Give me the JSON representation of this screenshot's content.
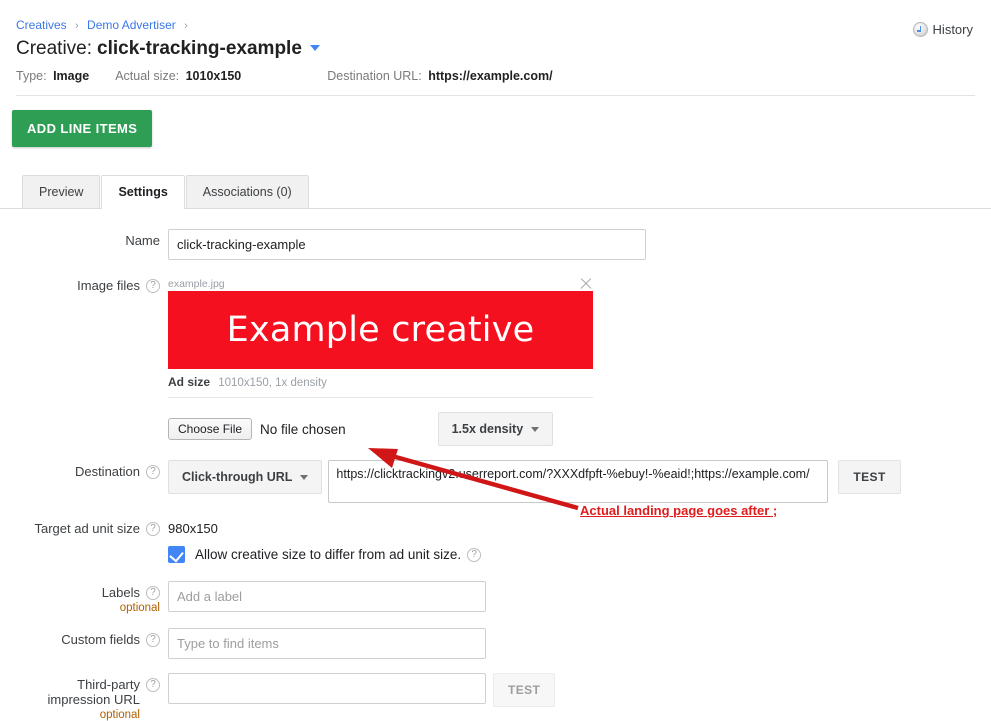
{
  "header": {
    "breadcrumb": [
      {
        "label": "Creatives"
      },
      {
        "label": "Demo Advertiser"
      }
    ],
    "breadcrumb_separator": "›",
    "title_prefix": "Creative:",
    "title_name": "click-tracking-example",
    "meta": [
      {
        "label": "Type:",
        "value": "Image"
      },
      {
        "label": "Actual size:",
        "value": "1010x150"
      },
      {
        "label": "Destination URL:",
        "value": "https://example.com/"
      }
    ],
    "history_label": "History",
    "history_icon": "clock-icon"
  },
  "toolbar": {
    "add_line_items_label": "ADD LINE ITEMS",
    "add_button_color": "#2e9e54"
  },
  "tabs": [
    {
      "label": "Preview",
      "active": false
    },
    {
      "label": "Settings",
      "active": true
    },
    {
      "label": "Associations (0)",
      "active": false
    }
  ],
  "form": {
    "help_icon_glyph": "?",
    "optional_label": "optional",
    "name": {
      "label": "Name",
      "value": "click-tracking-example"
    },
    "image_files": {
      "label": "Image files",
      "filename": "example.jpg",
      "remove_icon": "close-icon",
      "creative_text": "Example creative",
      "creative_color": "#f5101f",
      "ad_size_label": "Ad size",
      "ad_size_value": "1010x150, 1x density",
      "choose_file_label": "Choose File",
      "no_file_label": "No file chosen",
      "density_value": "1.5x density"
    },
    "destination": {
      "label": "Destination",
      "type_value": "Click-through URL",
      "url_value": "https://clicktrackingv2.userreport.com/?XXXdfpft-%ebuy!-%eaid!;https://example.com/",
      "test_label": "TEST"
    },
    "target_ad_unit_size": {
      "label": "Target ad unit size",
      "value": "980x150"
    },
    "allow_differ": {
      "label": "Allow creative size to differ from ad unit size.",
      "checked": true,
      "checkbox_color": "#4285f4"
    },
    "labels": {
      "label": "Labels",
      "placeholder": "Add a label",
      "value": ""
    },
    "custom_fields": {
      "label": "Custom fields",
      "placeholder": "Type to find items",
      "value": ""
    },
    "third_party_impression_url": {
      "label_line1": "Third-party",
      "label_line2": "impression URL",
      "placeholder": "",
      "value": "",
      "test_label": "TEST"
    }
  },
  "annotation": {
    "text": "Actual landing page goes after ;",
    "color": "#e01c1c"
  }
}
